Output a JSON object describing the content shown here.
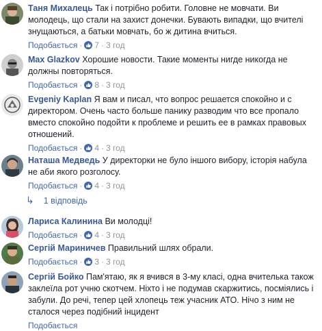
{
  "comments": [
    {
      "author": "Таня Михалець",
      "text": "Так і потрібно робити. Головне не мовчати. Ви молодець, що стали на захист донечки. Бувають випадки, що вчителі знущаються, а батьки мовчать, бо ж дитина вчиться.",
      "like_label": "Подобається",
      "likes": "7",
      "time": "3 год"
    },
    {
      "author": "Max Glazkov",
      "text": "Хорошие новости. Такие моменты нигде никогда не должны повторяться.",
      "like_label": "Подобається",
      "likes": "8",
      "time": "3 год"
    },
    {
      "author": "Evgeniy Kaplan",
      "text": "Я вам и писал, что вопрос решается спокойно и с директором. Очень часто больше панику разводим что все пропало вместо спокойно подойти к проблеме и решить ее в рамках правовых отношений.",
      "like_label": "Подобається",
      "likes": "4",
      "time": "3 год"
    },
    {
      "author": "Наташа Медведь",
      "text": "У директорки не було іншого вибору, історія набула не аби якого розголосу.",
      "like_label": "Подобається",
      "likes": "4",
      "time": "3 год"
    }
  ],
  "replies_link": "1 відповідь",
  "replies": [
    {
      "author": "Лариса Калинина",
      "text": "Ви молодці!",
      "like_label": "Подобається",
      "likes": "4",
      "time": "3 год"
    },
    {
      "author": "Сергій Мариничев",
      "text": "Правильний шлях обрали.",
      "like_label": "Подобається",
      "likes": "3",
      "time": "3 год"
    },
    {
      "author": "Сергій Бойко",
      "text": "Пам'ятаю, як я вчився в 3-му класі, одна вчителька також заклеїла рот учню скотчем. Ніхто і не подумав скаржитись, посміялись і забули. До речі, тепер цей хлопець теж учасник АТО. Нічо з ним не сталося через подібний інцидент",
      "like_label": "Подобається",
      "likes": "",
      "time": ""
    }
  ],
  "colors": {
    "author": "#385898",
    "link": "#4267b2",
    "meta": "#90949c",
    "like_badge": "#4267b2"
  }
}
